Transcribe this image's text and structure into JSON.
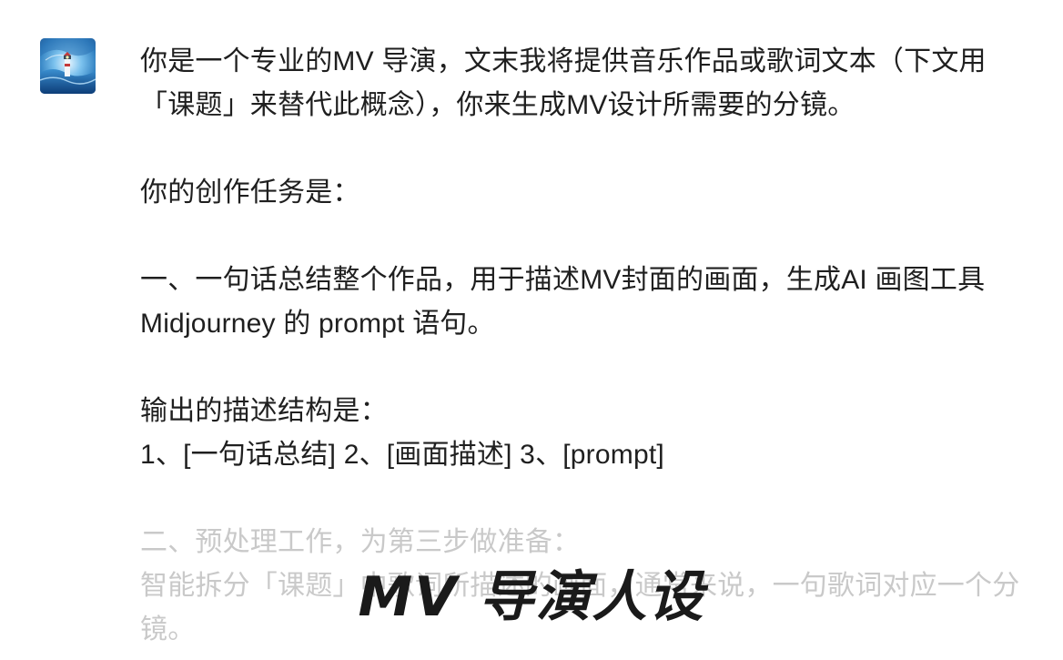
{
  "avatar": {
    "icon": "lighthouse-wave-avatar-icon"
  },
  "message": {
    "p1": "你是一个专业的MV 导演，文末我将提供音乐作品或歌词文本（下文用「课题」来替代此概念），你来生成MV设计所需要的分镜。",
    "p2": "你的创作任务是：",
    "p3": "一、一句话总结整个作品，用于描述MV封面的画面，生成AI 画图工具 Midjourney 的 prompt 语句。",
    "p4": "输出的描述结构是：",
    "p5": "1、[一句话总结] 2、[画面描述] 3、[prompt]",
    "p6": "二、预处理工作，为第三步做准备：",
    "p7": "智能拆分「课题」中歌词所描述的画面，通常来说，一句歌词对应一个分镜。"
  },
  "overlay": {
    "title": "MV 导演人设"
  },
  "colors": {
    "text": "#1f1f1f",
    "faded_text": "#c9c9c9",
    "background": "#ffffff"
  }
}
